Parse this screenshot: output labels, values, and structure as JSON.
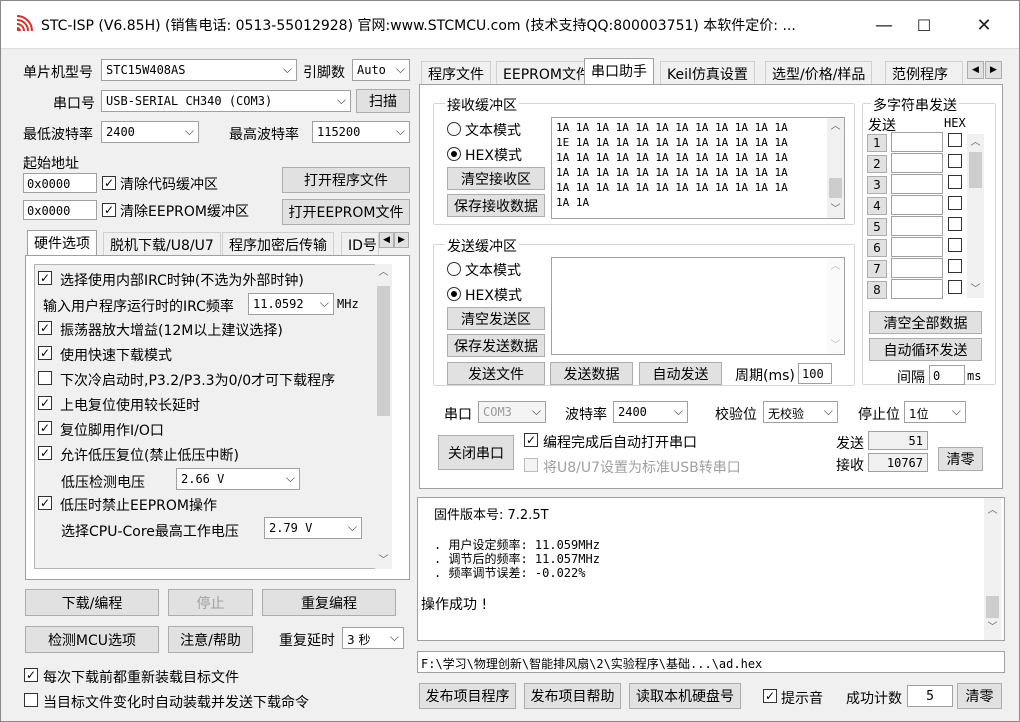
{
  "window": {
    "title": "STC-ISP (V6.85H) (销售电话: 0513-55012928) 官网:www.STCMCU.com  (技术支持QQ:800003751) 本软件定价: ...",
    "min": "—",
    "max": "☐",
    "close": "✕"
  },
  "left": {
    "mcu_label": "单片机型号",
    "mcu_value": "STC15W408AS",
    "pins_label": "引脚数",
    "pins_value": "Auto",
    "port_label": "串口号",
    "port_value": "USB-SERIAL CH340 (COM3)",
    "scan_btn": "扫描",
    "min_baud_label": "最低波特率",
    "min_baud_value": "2400",
    "max_baud_label": "最高波特率",
    "max_baud_value": "115200",
    "start_addr_label": "起始地址",
    "addr1": "0x0000",
    "clear_code_label": "清除代码缓冲区",
    "open_prog_btn": "打开程序文件",
    "addr2": "0x0000",
    "clear_eeprom_label": "清除EEPROM缓冲区",
    "open_eeprom_btn": "打开EEPROM文件",
    "tabs": [
      "硬件选项",
      "脱机下载/U8/U7",
      "程序加密后传输",
      "ID号"
    ],
    "options": [
      {
        "label": "选择使用内部IRC时钟(不选为外部时钟)",
        "checked": true
      },
      {
        "label": "振荡器放大增益(12M以上建议选择)",
        "checked": true
      },
      {
        "label": "使用快速下载模式",
        "checked": true
      },
      {
        "label": "下次冷启动时,P3.2/P3.3为0/0才可下载程序",
        "checked": false
      },
      {
        "label": "上电复位使用较长延时",
        "checked": true
      },
      {
        "label": "复位脚用作I/O口",
        "checked": true
      },
      {
        "label": "允许低压复位(禁止低压中断)",
        "checked": true
      },
      {
        "label": "低压时禁止EEPROM操作",
        "checked": true
      }
    ],
    "irc_label": "输入用户程序运行时的IRC频率",
    "irc_value": "11.0592",
    "irc_unit": "MHz",
    "lv_label": "低压检测电压",
    "lv_value": "2.66 V",
    "cpu_v_label": "选择CPU-Core最高工作电压",
    "cpu_v_value": "2.79 V",
    "download_btn": "下载/编程",
    "stop_btn": "停止",
    "reprog_btn": "重复编程",
    "detect_btn": "检测MCU选项",
    "help_btn": "注意/帮助",
    "repeat_delay_label": "重复延时",
    "repeat_delay_value": "3 秒",
    "reload_label": "每次下载前都重新装载目标文件",
    "auto_send_label": "当目标文件变化时自动装载并发送下载命令"
  },
  "right": {
    "tabs": [
      "程序文件",
      "EEPROM文件",
      "串口助手",
      "Keil仿真设置",
      "选型/价格/样品",
      "范例程序"
    ],
    "recv_group": "接收缓冲区",
    "text_mode": "文本模式",
    "hex_mode": "HEX模式",
    "clear_recv_btn": "清空接收区",
    "save_recv_btn": "保存接收数据",
    "recv_data": "1A 1A 1A 1A 1A 1A 1A 1A 1A 1A 1A 1A\n1E 1A 1A 1A 1A 1A 1A 1A 1A 1A 1A 1A\n1A 1A 1A 1A 1A 1A 1A 1A 1A 1A 1A 1A\n1A 1A 1A 1A 1A 1A 1A 1A 1A 1A 1A 1A\n1A 1A 1A 1A 1A 1A 1A 1A 1A 1A 1A 1A\n1A 1A",
    "send_group": "发送缓冲区",
    "clear_send_btn": "清空发送区",
    "save_send_btn": "保存发送数据",
    "send_file_btn": "发送文件",
    "send_data_btn": "发送数据",
    "auto_send_btn": "自动发送",
    "period_label": "周期(ms)",
    "period_value": "100",
    "multi_group": "多字符串发送",
    "send_hdr": "发送",
    "hex_hdr": "HEX",
    "multi_rows": [
      "1",
      "2",
      "3",
      "4",
      "5",
      "6",
      "7",
      "8"
    ],
    "clear_all_btn": "清空全部数据",
    "auto_loop_btn": "自动循环发送",
    "interval_label": "间隔",
    "interval_value": "0",
    "interval_unit": "ms",
    "port_label": "串口",
    "port_value": "COM3",
    "baud_label": "波特率",
    "baud_value": "2400",
    "parity_label": "校验位",
    "parity_value": "无校验",
    "stop_label": "停止位",
    "stop_value": "1位",
    "close_port_btn": "关闭串口",
    "auto_open_label": "编程完成后自动打开串口",
    "u8_label": "将U8/U7设置为标准USB转串口",
    "sent_label": "发送",
    "sent_value": "51",
    "recv_label": "接收",
    "recv_value": "10767",
    "clear_count_btn": "清零"
  },
  "log": {
    "line1": "固件版本号: 7.2.5T",
    "line2": ". 用户设定频率: 11.059MHz",
    "line3": ". 调节后的频率: 11.057MHz",
    "line4": ". 频率调节误差: -0.022%",
    "line5": "操作成功 !"
  },
  "bottom": {
    "path": "F:\\学习\\物理创新\\智能排风扇\\2\\实验程序\\基础...\\ad.hex",
    "publish_btn": "发布项目程序",
    "publish_help_btn": "发布项目帮助",
    "read_disk_btn": "读取本机硬盘号",
    "beep_label": "提示音",
    "success_label": "成功计数",
    "success_value": "5",
    "clear_btn": "清零"
  }
}
